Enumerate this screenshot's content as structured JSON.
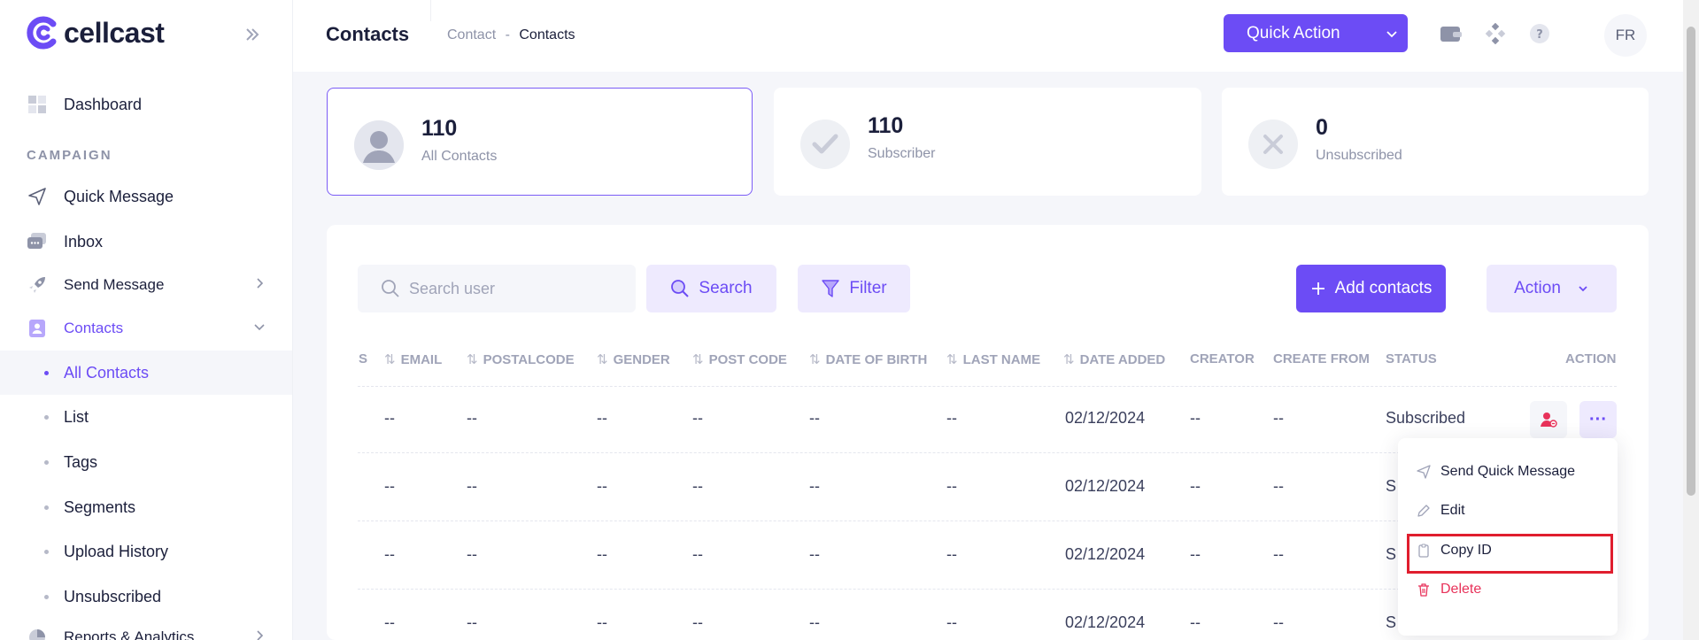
{
  "brand": {
    "name": "cellcast",
    "color": "#6c4cf5"
  },
  "sidebar": {
    "dashboard": "Dashboard",
    "section_campaign": "CAMPAIGN",
    "quick_message": "Quick Message",
    "inbox": "Inbox",
    "send_message": "Send Message",
    "contacts": "Contacts",
    "sub_items": [
      "All Contacts",
      "List",
      "Tags",
      "Segments",
      "Upload History",
      "Unsubscribed"
    ],
    "reports": "Reports & Analytics"
  },
  "header": {
    "title": "Contacts",
    "breadcrumb_parent": "Contact",
    "breadcrumb_sep": "-",
    "breadcrumb_current": "Contacts",
    "quick_action": "Quick Action",
    "avatar_initials": "FR"
  },
  "stats": [
    {
      "value": "110",
      "label": "All Contacts"
    },
    {
      "value": "110",
      "label": "Subscriber"
    },
    {
      "value": "0",
      "label": "Unsubscribed"
    }
  ],
  "toolbar": {
    "search_placeholder": "Search user",
    "search_label": "Search",
    "filter_label": "Filter",
    "add_contacts_label": "Add contacts",
    "action_label": "Action"
  },
  "table": {
    "partial_header": "S",
    "columns": [
      "EMAIL",
      "POSTALCODE",
      "GENDER",
      "POST CODE",
      "DATE OF BIRTH",
      "LAST NAME",
      "DATE ADDED",
      "CREATOR",
      "CREATE FROM",
      "STATUS",
      "ACTION"
    ],
    "rows": [
      {
        "email": "--",
        "postalcode": "--",
        "gender": "--",
        "post_code": "--",
        "dob": "--",
        "last_name": "--",
        "date_added": "02/12/2024",
        "creator": "--",
        "create_from": "--",
        "status": "Subscribed"
      },
      {
        "email": "--",
        "postalcode": "--",
        "gender": "--",
        "post_code": "--",
        "dob": "--",
        "last_name": "--",
        "date_added": "02/12/2024",
        "creator": "--",
        "create_from": "--",
        "status": "S"
      },
      {
        "email": "--",
        "postalcode": "--",
        "gender": "--",
        "post_code": "--",
        "dob": "--",
        "last_name": "--",
        "date_added": "02/12/2024",
        "creator": "--",
        "create_from": "--",
        "status": "S"
      },
      {
        "email": "--",
        "postalcode": "--",
        "gender": "--",
        "post_code": "--",
        "dob": "--",
        "last_name": "--",
        "date_added": "02/12/2024",
        "creator": "--",
        "create_from": "--",
        "status": "S"
      }
    ]
  },
  "dropdown": {
    "send_quick_message": "Send Quick Message",
    "edit": "Edit",
    "copy_id": "Copy ID",
    "delete": "Delete"
  }
}
